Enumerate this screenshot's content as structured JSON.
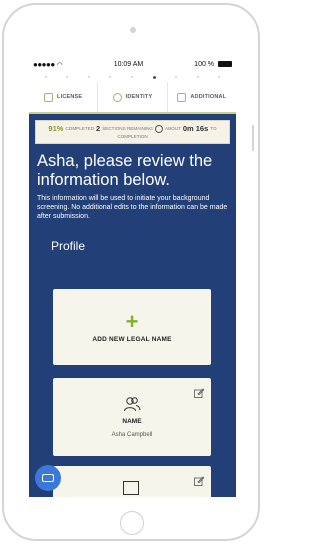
{
  "status_bar": {
    "time": "10:09 AM",
    "battery": "100 %"
  },
  "tabs": [
    {
      "label": "LICENSE",
      "icon": "license-icon"
    },
    {
      "label": "IDENTITY",
      "icon": "identity-icon"
    },
    {
      "label": "ADDITIONAL",
      "icon": "additional-icon"
    }
  ],
  "progress": {
    "percent": "91%",
    "completed_label": "COMPLETED",
    "sections_count": "2",
    "sections_label": "SECTIONS REMAINING",
    "about_label": "ABOUT",
    "time_value": "0m 16s",
    "to_label": "TO",
    "completion_label": "COMPLETION"
  },
  "headline": "Asha, please review the information below.",
  "description": "This information will be used to initiate your background screening. No additional edits to the information can be made after submission.",
  "profile": {
    "section_title": "Profile",
    "add_legal_name_label": "ADD NEW LEGAL NAME",
    "name_card": {
      "label": "NAME",
      "value": "Asha Campbell"
    }
  },
  "colors": {
    "background": "#223f78",
    "accent": "#7bb52e",
    "card": "#f6f5ec",
    "chat": "#3b78d8"
  }
}
